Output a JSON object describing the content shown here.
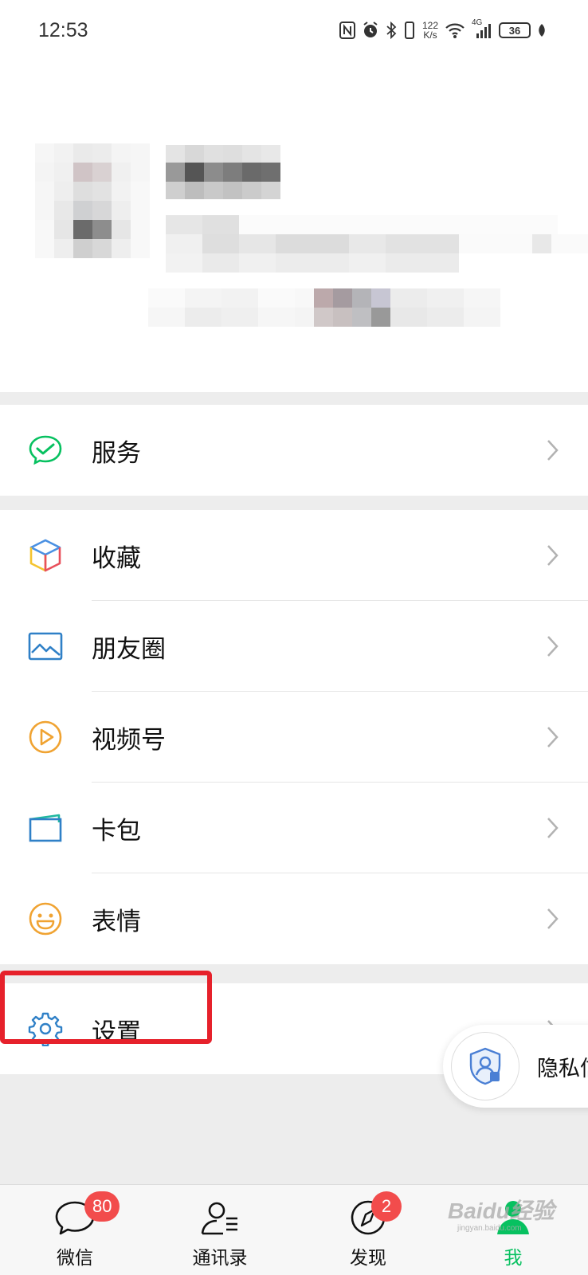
{
  "status_bar": {
    "time": "12:53",
    "net_speed_value": "122",
    "net_speed_unit": "K/s",
    "network_type": "4G",
    "battery": "36",
    "icons": [
      "nfc-icon",
      "alarm-icon",
      "bluetooth-icon",
      "vibrate-icon",
      "wifi-icon",
      "signal-icon",
      "battery-icon",
      "leaf-icon"
    ]
  },
  "menu": {
    "services": {
      "label": "服务",
      "icon": "wechat-pay-icon"
    },
    "items": [
      {
        "label": "收藏",
        "icon": "favorites-cube-icon"
      },
      {
        "label": "朋友圈",
        "icon": "moments-picture-icon"
      },
      {
        "label": "视频号",
        "icon": "channels-play-icon"
      },
      {
        "label": "卡包",
        "icon": "card-wallet-icon"
      },
      {
        "label": "表情",
        "icon": "sticker-smile-icon"
      }
    ],
    "settings": {
      "label": "设置",
      "icon": "gear-icon"
    }
  },
  "privacy_popup": {
    "text": "隐私信",
    "icon": "shield-user-icon"
  },
  "tabbar": {
    "tabs": [
      {
        "label": "微信",
        "badge": "80",
        "icon": "chat-bubble-icon"
      },
      {
        "label": "通讯录",
        "icon": "contacts-icon"
      },
      {
        "label": "发现",
        "badge": "2",
        "icon": "compass-icon"
      },
      {
        "label": "我",
        "icon": "me-person-icon",
        "active": true
      }
    ]
  },
  "watermark": {
    "text": "Baidu经验",
    "sub": "jingyan.baidu.com"
  },
  "colors": {
    "accent_green": "#07c160",
    "badge_red": "#f24c4c",
    "highlight_red": "#e6212b",
    "background": "#ededed"
  }
}
